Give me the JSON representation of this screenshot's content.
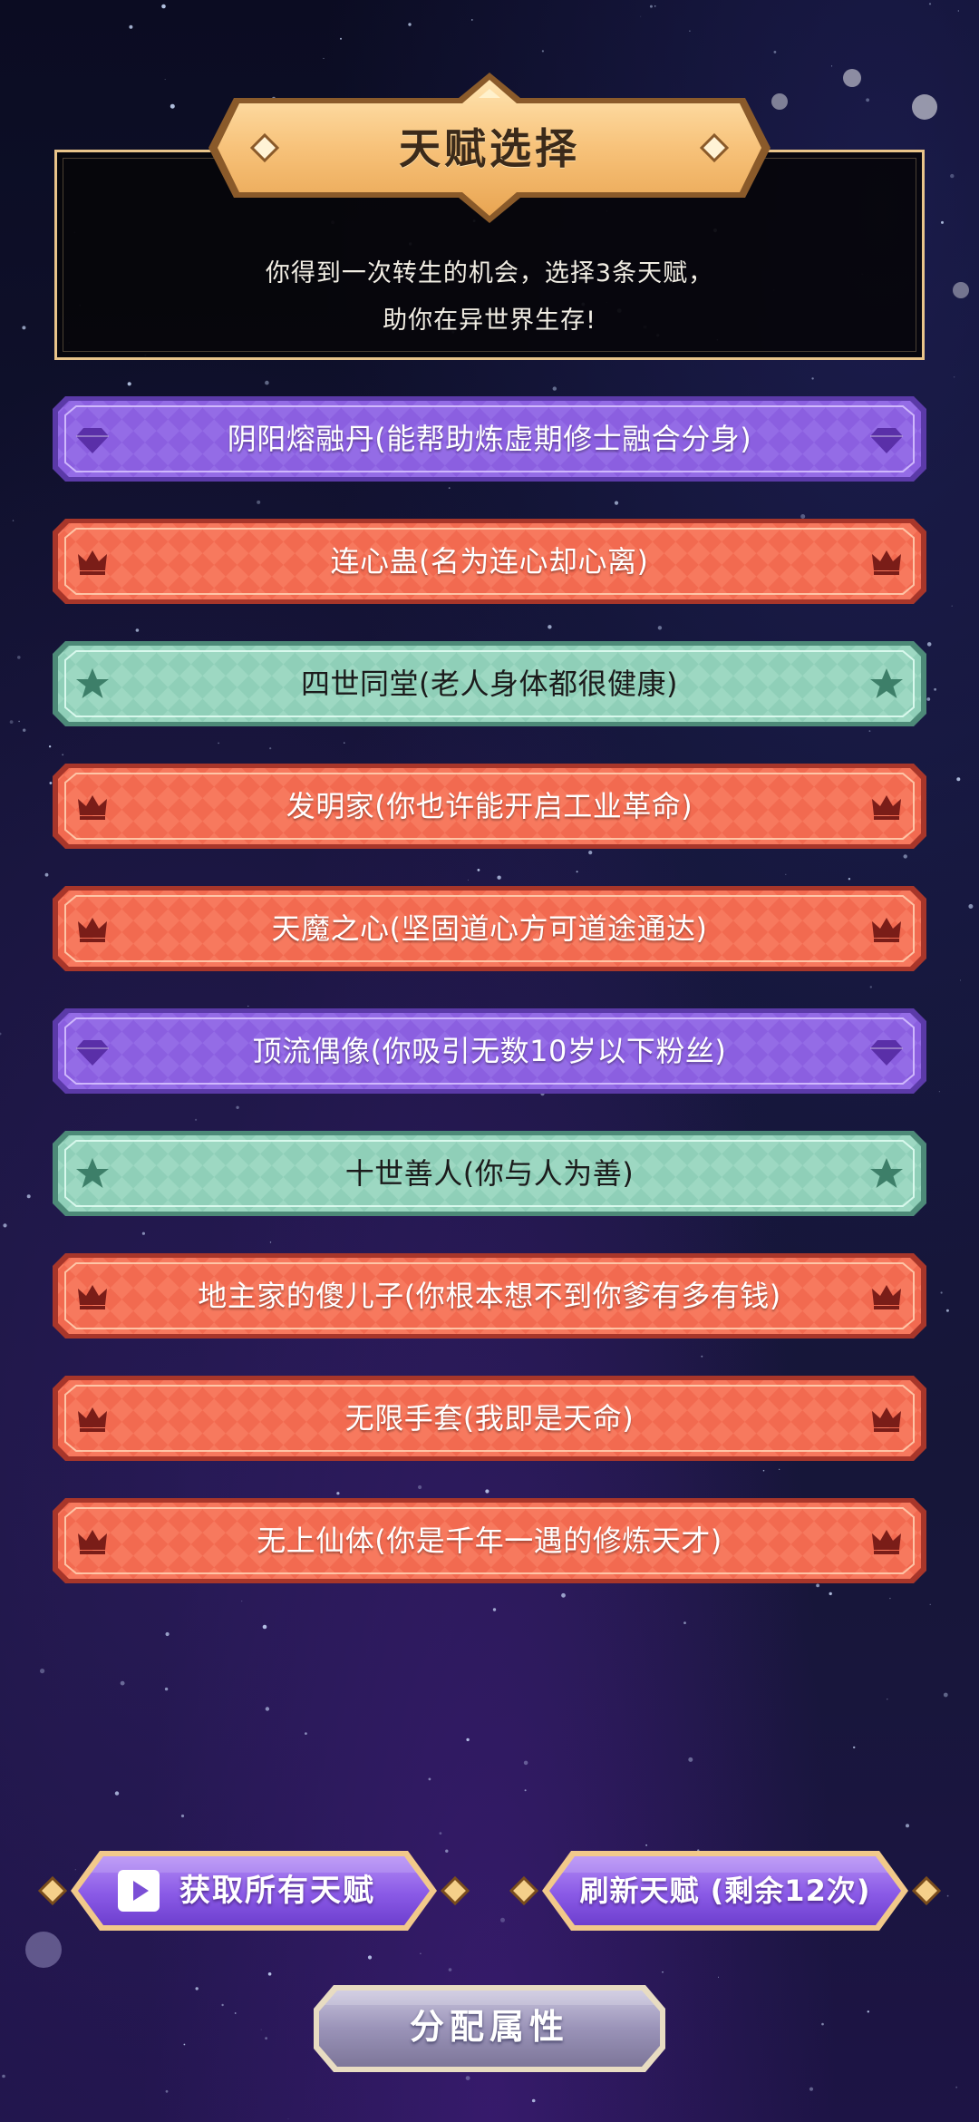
{
  "header": {
    "title": "天赋选择",
    "subtitle_line1": "你得到一次转生的机会，选择3条天赋，",
    "subtitle_line2": "助你在异世界生存!"
  },
  "talents": [
    {
      "label": "阴阳熔融丹(能帮助炼虚期修士融合分身)",
      "tier": "purple",
      "icon": "diamond-icon"
    },
    {
      "label": "连心蛊(名为连心却心离)",
      "tier": "red",
      "icon": "crown-icon"
    },
    {
      "label": "四世同堂(老人身体都很健康)",
      "tier": "teal",
      "icon": "star-icon"
    },
    {
      "label": "发明家(你也许能开启工业革命)",
      "tier": "red",
      "icon": "crown-icon"
    },
    {
      "label": "天魔之心(坚固道心方可道途通达)",
      "tier": "red",
      "icon": "crown-icon"
    },
    {
      "label": "顶流偶像(你吸引无数10岁以下粉丝)",
      "tier": "purple",
      "icon": "diamond-icon"
    },
    {
      "label": "十世善人(你与人为善)",
      "tier": "teal",
      "icon": "star-icon"
    },
    {
      "label": "地主家的傻儿子(你根本想不到你爹有多有钱)",
      "tier": "red",
      "icon": "crown-icon"
    },
    {
      "label": "无限手套(我即是天命)",
      "tier": "red",
      "icon": "crown-icon"
    },
    {
      "label": "无上仙体(你是千年一遇的修炼天才)",
      "tier": "red",
      "icon": "crown-icon"
    }
  ],
  "buttons": {
    "get_all": "获取所有天赋",
    "refresh": "刷新天赋 (剩余12次)",
    "assign": "分配属性"
  },
  "colors": {
    "purple": "#8b5fe0",
    "red": "#f26a50",
    "teal": "#8fcfb8",
    "gold": "#f2c070",
    "frame": "#e9c48a"
  }
}
